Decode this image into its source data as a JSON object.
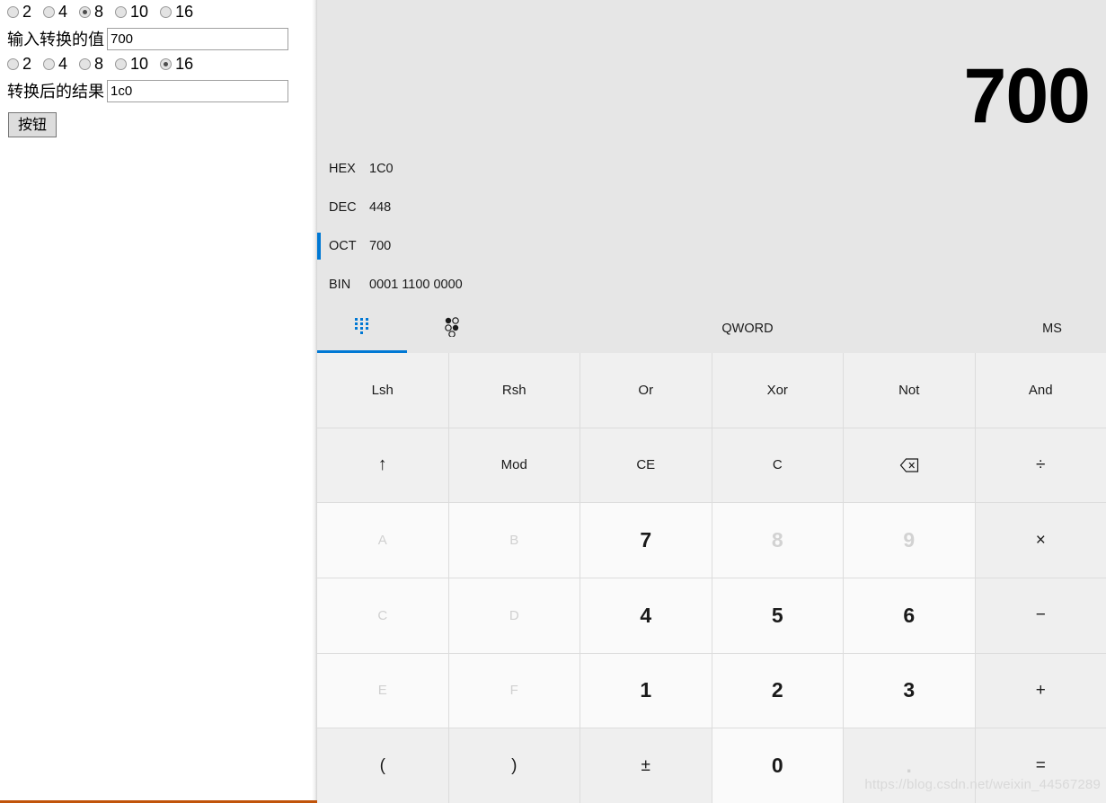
{
  "left_form": {
    "input_radix_group": {
      "name": "input-radix",
      "options": [
        {
          "label": "2",
          "selected": false
        },
        {
          "label": "4",
          "selected": false
        },
        {
          "label": "8",
          "selected": true
        },
        {
          "label": "10",
          "selected": false
        },
        {
          "label": "16",
          "selected": false
        }
      ]
    },
    "input_field": {
      "label": "输入转换的值",
      "value": "700",
      "placeholder": ""
    },
    "output_radix_group": {
      "name": "output-radix",
      "options": [
        {
          "label": "2",
          "selected": false
        },
        {
          "label": "4",
          "selected": false
        },
        {
          "label": "8",
          "selected": false
        },
        {
          "label": "10",
          "selected": false
        },
        {
          "label": "16",
          "selected": true
        }
      ]
    },
    "output_field": {
      "label": "转换后的结果",
      "value": "1c0",
      "placeholder": ""
    },
    "submit_button": {
      "label": "按钮"
    }
  },
  "calculator": {
    "display": {
      "value": "700"
    },
    "radix_rows": [
      {
        "name": "HEX",
        "value": "1C0",
        "active": false
      },
      {
        "name": "DEC",
        "value": "448",
        "active": false
      },
      {
        "name": "OCT",
        "value": "700",
        "active": true
      },
      {
        "name": "BIN",
        "value": "0001 1100 0000",
        "active": false
      }
    ],
    "toolbar": {
      "keypad_icon": "keypad-icon",
      "bits_icon": "bit-toggle-icon",
      "word_size": "QWORD",
      "memory": "MS"
    },
    "keys": [
      [
        {
          "label": "Lsh",
          "kind": "func",
          "name": "key-lsh",
          "disabled": false
        },
        {
          "label": "Rsh",
          "kind": "func",
          "name": "key-rsh",
          "disabled": false
        },
        {
          "label": "Or",
          "kind": "func",
          "name": "key-or",
          "disabled": false
        },
        {
          "label": "Xor",
          "kind": "func",
          "name": "key-xor",
          "disabled": false
        },
        {
          "label": "Not",
          "kind": "func",
          "name": "key-not",
          "disabled": false
        },
        {
          "label": "And",
          "kind": "func",
          "name": "key-and",
          "disabled": false
        }
      ],
      [
        {
          "label": "↑",
          "kind": "symbol",
          "name": "key-shift-up",
          "disabled": false
        },
        {
          "label": "Mod",
          "kind": "func",
          "name": "key-mod",
          "disabled": false
        },
        {
          "label": "CE",
          "kind": "func",
          "name": "key-clear-entry",
          "disabled": false
        },
        {
          "label": "C",
          "kind": "func",
          "name": "key-clear",
          "disabled": false
        },
        {
          "label": "",
          "kind": "bksp",
          "name": "key-backspace",
          "disabled": false
        },
        {
          "label": "÷",
          "kind": "op",
          "name": "key-divide",
          "disabled": false
        }
      ],
      [
        {
          "label": "A",
          "kind": "hexdim",
          "name": "key-hex-a",
          "disabled": true
        },
        {
          "label": "B",
          "kind": "hexdim",
          "name": "key-hex-b",
          "disabled": true
        },
        {
          "label": "7",
          "kind": "digit",
          "name": "key-7",
          "disabled": false
        },
        {
          "label": "8",
          "kind": "digit",
          "name": "key-8",
          "disabled": true
        },
        {
          "label": "9",
          "kind": "digit",
          "name": "key-9",
          "disabled": true
        },
        {
          "label": "×",
          "kind": "op",
          "name": "key-multiply",
          "disabled": false
        }
      ],
      [
        {
          "label": "C",
          "kind": "hexdim",
          "name": "key-hex-c",
          "disabled": true
        },
        {
          "label": "D",
          "kind": "hexdim",
          "name": "key-hex-d",
          "disabled": true
        },
        {
          "label": "4",
          "kind": "digit",
          "name": "key-4",
          "disabled": false
        },
        {
          "label": "5",
          "kind": "digit",
          "name": "key-5",
          "disabled": false
        },
        {
          "label": "6",
          "kind": "digit",
          "name": "key-6",
          "disabled": false
        },
        {
          "label": "−",
          "kind": "op",
          "name": "key-subtract",
          "disabled": false
        }
      ],
      [
        {
          "label": "E",
          "kind": "hexdim",
          "name": "key-hex-e",
          "disabled": true
        },
        {
          "label": "F",
          "kind": "hexdim",
          "name": "key-hex-f",
          "disabled": true
        },
        {
          "label": "1",
          "kind": "digit",
          "name": "key-1",
          "disabled": false
        },
        {
          "label": "2",
          "kind": "digit",
          "name": "key-2",
          "disabled": false
        },
        {
          "label": "3",
          "kind": "digit",
          "name": "key-3",
          "disabled": false
        },
        {
          "label": "+",
          "kind": "op",
          "name": "key-add",
          "disabled": false
        }
      ],
      [
        {
          "label": "(",
          "kind": "op",
          "name": "key-paren-open",
          "disabled": false
        },
        {
          "label": ")",
          "kind": "op",
          "name": "key-paren-close",
          "disabled": false
        },
        {
          "label": "±",
          "kind": "op",
          "name": "key-plus-minus",
          "disabled": false
        },
        {
          "label": "0",
          "kind": "digit",
          "name": "key-0",
          "disabled": false
        },
        {
          "label": ".",
          "kind": "small-dot",
          "name": "key-decimal",
          "disabled": true
        },
        {
          "label": "=",
          "kind": "op",
          "name": "key-equals",
          "disabled": false
        }
      ]
    ]
  },
  "watermark": {
    "text": "https://blog.csdn.net/weixin_44567289"
  },
  "colors": {
    "accent": "#0078d4",
    "calc_background": "#e6e6e6",
    "digit_key": "#fafafa",
    "func_key": "#f0f0f0",
    "op_key": "#efefef",
    "panel_bottom_border": "#c1540a",
    "disabled_text": "#d2d2d2"
  }
}
